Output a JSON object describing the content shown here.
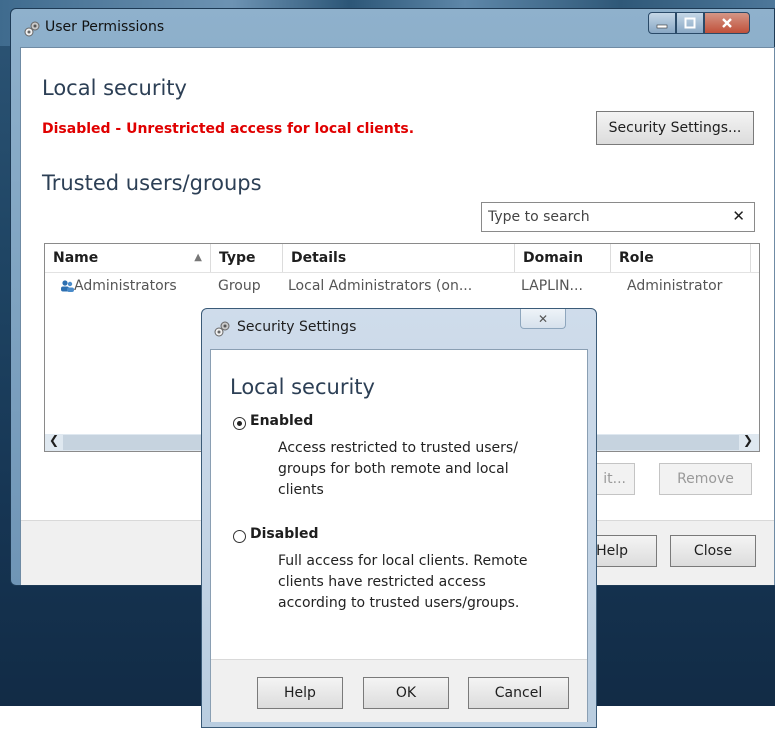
{
  "main_window": {
    "title": "User Permissions",
    "local_security_heading": "Local security",
    "status_warning": "Disabled - Unrestricted access for local clients.",
    "security_settings_button": "Security Settings...",
    "trusted_heading": "Trusted users/groups",
    "search_placeholder": "Type to search",
    "search_clear": "✕",
    "table": {
      "columns": [
        "Name",
        "Type",
        "Details",
        "Domain",
        "Role"
      ],
      "rows": [
        {
          "name": "Administrators",
          "type": "Group",
          "details": "Local Administrators (on...",
          "domain": "LAPLIN...",
          "role": "Administrator"
        }
      ]
    },
    "scroll_left": "❮",
    "scroll_right": "❯",
    "edit_button_partial": "it...",
    "remove_button": "Remove",
    "help_button_partial": "Help",
    "close_button": "Close"
  },
  "dialog": {
    "title": "Security Settings",
    "close_glyph": "✕",
    "heading": "Local security",
    "options": [
      {
        "label": "Enabled",
        "selected": true,
        "description": [
          "Access restricted to trusted users/",
          "groups for both remote and local",
          "clients"
        ]
      },
      {
        "label": "Disabled",
        "selected": false,
        "description": [
          "Full access for local clients. Remote",
          "clients have restricted access",
          "according to trusted users/groups."
        ]
      }
    ],
    "help_button": "Help",
    "ok_button": "OK",
    "cancel_button": "Cancel"
  },
  "colors": {
    "warning": "#e00000",
    "heading": "#2c3f55",
    "titlebar": "#8fb1cc",
    "close_button": "#c0503a"
  },
  "icons": {
    "app": "gear-pair-icon",
    "user_group": "user-group-icon"
  }
}
